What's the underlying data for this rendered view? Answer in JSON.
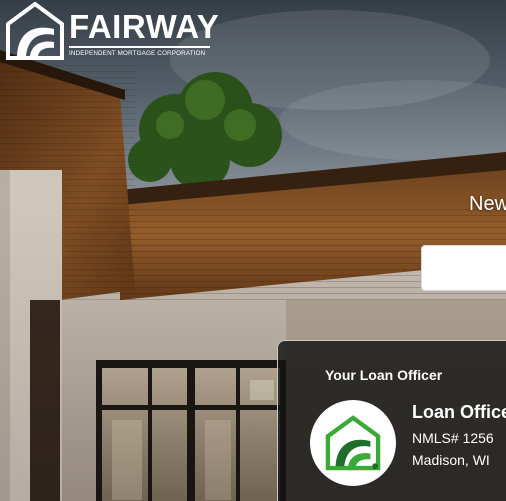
{
  "brand": {
    "name": "FAIRWAY",
    "tagline": "INDEPENDENT MORTGAGE CORPORATION"
  },
  "hero": {
    "heading": "New",
    "input_value": ""
  },
  "loan_officer": {
    "section_title": "Your Loan Officer",
    "name": "Loan Office",
    "nmls": "NMLS# 1256",
    "location": "Madison, WI",
    "avatar_icon": "fairway-logo-icon"
  },
  "colors": {
    "brand_green": "#3aa935",
    "brand_dark_green": "#1f6e2c",
    "card_bg": "#141412",
    "text": "#ffffff"
  }
}
